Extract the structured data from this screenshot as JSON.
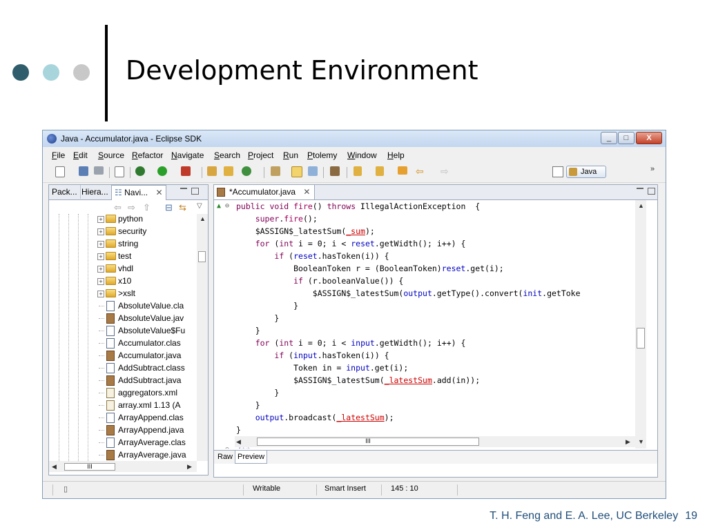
{
  "slide": {
    "title": "Development Environment",
    "footer": "T. H. Feng and E. A. Lee, UC Berkeley",
    "page_number": "19",
    "dot_colors": [
      "#2f5d6b",
      "#a8d5dc",
      "#c8c8c8"
    ]
  },
  "window": {
    "title": "Java - Accumulator.java - Eclipse SDK",
    "minimize_icon": "minimize-icon",
    "maximize_icon": "maximize-icon",
    "close_label": "X"
  },
  "menu": [
    "File",
    "Edit",
    "Source",
    "Refactor",
    "Navigate",
    "Search",
    "Project",
    "Run",
    "Ptolemy",
    "Window",
    "Help"
  ],
  "perspective": {
    "label": "Java"
  },
  "left_pane": {
    "tabs": [
      "Pack...",
      "Hiera...",
      "Navi..."
    ],
    "close": "✕",
    "tree": [
      {
        "label": "python",
        "kind": "folder"
      },
      {
        "label": "security",
        "kind": "folder"
      },
      {
        "label": "string",
        "kind": "folder"
      },
      {
        "label": "test",
        "kind": "folder"
      },
      {
        "label": "vhdl",
        "kind": "folder"
      },
      {
        "label": "x10",
        "kind": "folder"
      },
      {
        "label": ">xslt",
        "kind": "folder"
      },
      {
        "label": "AbsoluteValue.cla",
        "kind": "class"
      },
      {
        "label": "AbsoluteValue.jav",
        "kind": "java"
      },
      {
        "label": "AbsoluteValue$Fu",
        "kind": "class"
      },
      {
        "label": "Accumulator.clas",
        "kind": "class"
      },
      {
        "label": "Accumulator.java",
        "kind": "java"
      },
      {
        "label": "AddSubtract.class",
        "kind": "class"
      },
      {
        "label": "AddSubtract.java",
        "kind": "java"
      },
      {
        "label": "aggregators.xml",
        "kind": "xml"
      },
      {
        "label": "array.xml  1.13  (A",
        "kind": "xml"
      },
      {
        "label": "ArrayAppend.clas",
        "kind": "class"
      },
      {
        "label": "ArrayAppend.java",
        "kind": "java"
      },
      {
        "label": "ArrayAverage.clas",
        "kind": "class"
      },
      {
        "label": "ArrayAverage.java",
        "kind": "java"
      }
    ]
  },
  "editor": {
    "tab_label": "*Accumulator.java",
    "close": "✕",
    "bottom_tabs": [
      "Raw",
      "Preview"
    ],
    "comment_line": "/**"
  },
  "status": {
    "writable": "Writable",
    "insert_mode": "Smart Insert",
    "position": "145 : 10"
  }
}
